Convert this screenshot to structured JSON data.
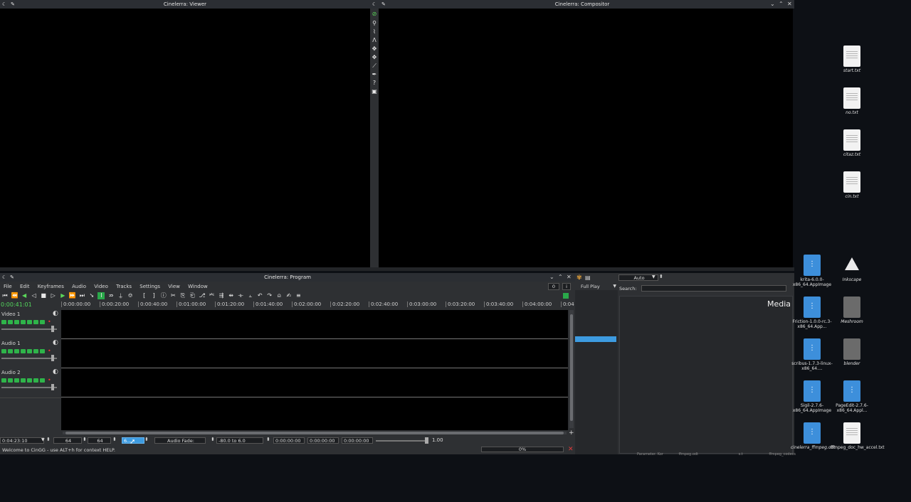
{
  "viewer": {
    "title": "Cinelerra: Viewer"
  },
  "compositor": {
    "title": "Cinelerra: Compositor"
  },
  "program": {
    "title": "Cinelerra: Program",
    "menu": [
      "File",
      "Edit",
      "Keyframes",
      "Audio",
      "Video",
      "Tracks",
      "Settings",
      "View",
      "Window"
    ],
    "time_display": "0:00:41:01",
    "counter_box": "0",
    "info_box": "i",
    "ruler": [
      "0:00:00:00",
      "0:00:20:00",
      "0:00:40:00",
      "0:01:00:00",
      "0:01:20:00",
      "0:01:40:00",
      "0:02:00:00",
      "0:02:20:00",
      "0:02:40:00",
      "0:03:00:00",
      "0:03:20:00",
      "0:03:40:00",
      "0:04:00:00",
      "0:04"
    ],
    "tracks": [
      {
        "name": "Video 1"
      },
      {
        "name": "Audio 1"
      },
      {
        "name": "Audio 2"
      }
    ],
    "bottom": {
      "duration": "0:04:23:10",
      "zoom1": "64",
      "zoom2": "64",
      "selected_dropdown": "6...",
      "audio_fade": "Audio Fade:",
      "range": "-80.0 to 6.0",
      "t1": "0:00:00:00",
      "t2": "0:00:00:00",
      "t3": "0:00:00:00",
      "value": "1.00",
      "progress_text": "0%",
      "progress": 0
    },
    "status": "Welcome to CinGG - use ALT+h for context HELP."
  },
  "resources": {
    "play_mode": "Full Play",
    "format": "Auto",
    "search_label": "Search:",
    "media_label": "Media",
    "bg_filenames": [
      "Parameter. Kor",
      "ffmpeg.odt",
      "s.t",
      "ffmpeg_codecs"
    ]
  },
  "desktop_icons": [
    {
      "label": "start.txt",
      "kind": "doc"
    },
    {
      "label": "no.txt",
      "kind": "doc"
    },
    {
      "label": "citaz.txt",
      "kind": "doc"
    },
    {
      "label": "cin.txt",
      "kind": "doc"
    },
    {
      "label": "krita-6.0.0-x86_64.AppImage",
      "kind": "blue"
    },
    {
      "label": "Inkscape",
      "kind": "inkscape"
    },
    {
      "label": "Friction-1.0.0-rc.3-x86_64.App...",
      "kind": "blue"
    },
    {
      "label": "Meshroom",
      "kind": "grey"
    },
    {
      "label": "scribus-1.7.3-linux-x86_64....",
      "kind": "blue"
    },
    {
      "label": "blender",
      "kind": "grey"
    },
    {
      "label": "Sigil-2.7.6-x86_64.AppImage",
      "kind": "blue"
    },
    {
      "label": "PageEdit-2.7.6-x86_64.Appl...",
      "kind": "blue"
    },
    {
      "label": "cinelerra_ffmpeg.odt",
      "kind": "blue"
    },
    {
      "label": "ffmpeg_doc_hw_accel.txt",
      "kind": "doc"
    }
  ]
}
